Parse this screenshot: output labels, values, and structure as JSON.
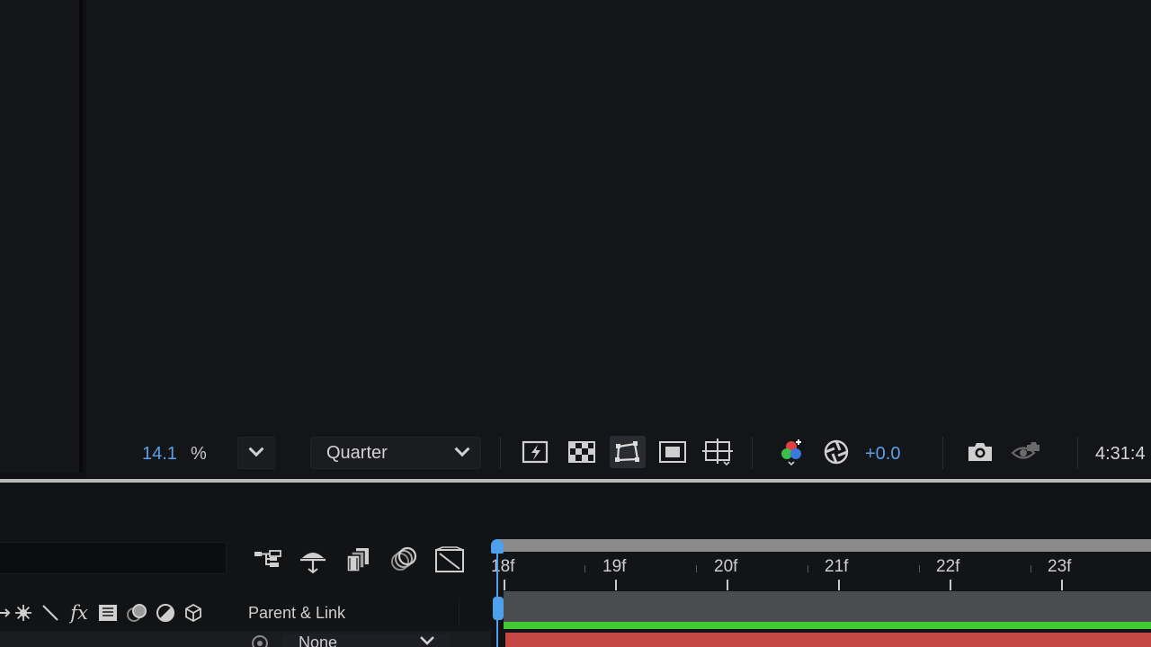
{
  "viewer_toolbar": {
    "zoom_value": "14.1",
    "zoom_unit": "%",
    "resolution": "Quarter",
    "exposure": "+0.0",
    "timecode": "4:31:4"
  },
  "timeline": {
    "column_header": "Parent & Link",
    "parent_value": "None",
    "ruler_labels": [
      "18f",
      "19f",
      "20f",
      "21f",
      "22f",
      "23f"
    ]
  },
  "colors": {
    "accent_blue": "#5aa0ea",
    "layer_bar_red": "#c44745",
    "work_area_green": "#43c935"
  }
}
